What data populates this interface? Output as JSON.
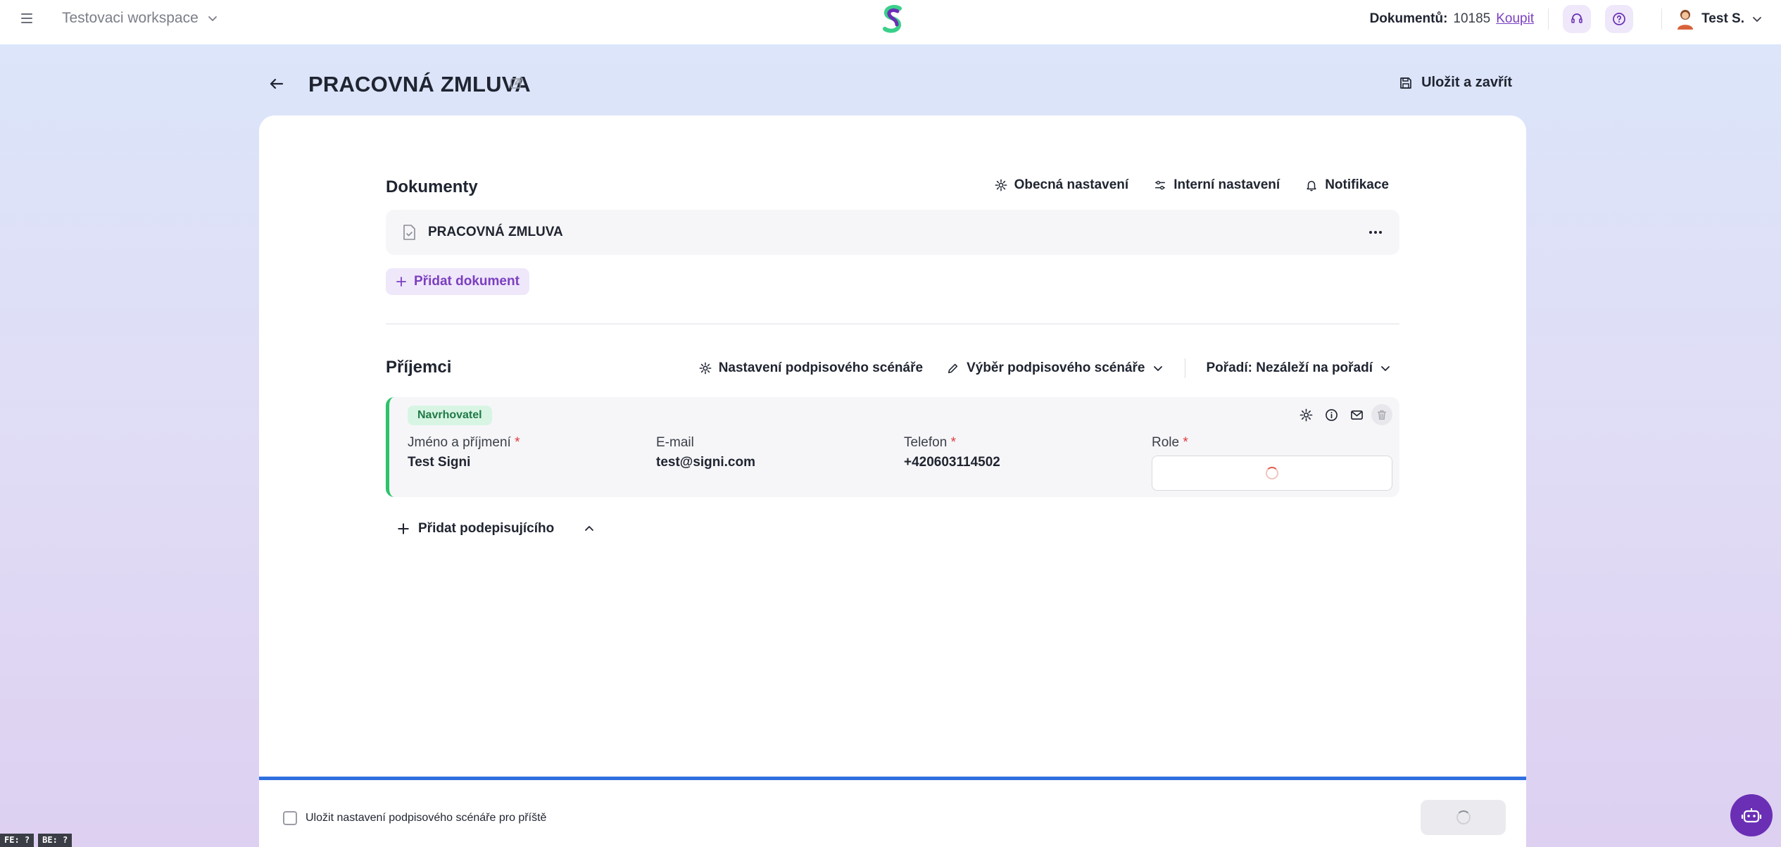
{
  "topbar": {
    "workspace": "Testovaci workspace",
    "documents_label": "Dokumentů:",
    "documents_count": "10185",
    "buy_label": "Koupit",
    "user_name": "Test S."
  },
  "header": {
    "title": "PRACOVNÁ ZMLUVA",
    "save_close": "Uložit a zavřít"
  },
  "documents": {
    "title": "Dokumenty",
    "general_settings": "Obecná nastavení",
    "internal_settings": "Interní nastavení",
    "notifications": "Notifikace",
    "items": [
      {
        "name": "PRACOVNÁ ZMLUVA"
      }
    ],
    "add_document": "Přidat dokument"
  },
  "recipients": {
    "title": "Příjemci",
    "scenario_settings": "Nastavení podpisového scénáře",
    "scenario_select": "Výběr podpisového scénáře",
    "order": "Pořadí: Nezáleží na pořadí",
    "items": [
      {
        "badge": "Navrhovatel",
        "name_label": "Jméno a příjmení",
        "name": "Test Signi",
        "email_label": "E-mail",
        "email": "test@signi.com",
        "phone_label": "Telefon",
        "phone": "+420603114502",
        "role_label": "Role"
      }
    ],
    "add_signer": "Přidat podepisujícího"
  },
  "footer": {
    "save_scenario_label": "Uložit nastavení podpisového scénáře pro příště"
  },
  "debug": {
    "fe": "FE: ?",
    "be": "BE: ?"
  },
  "colors": {
    "accent": "#7b3fbf",
    "badge_green": "#2cc36b",
    "progress_blue": "#2f6fe0",
    "required": "#e0393e"
  }
}
